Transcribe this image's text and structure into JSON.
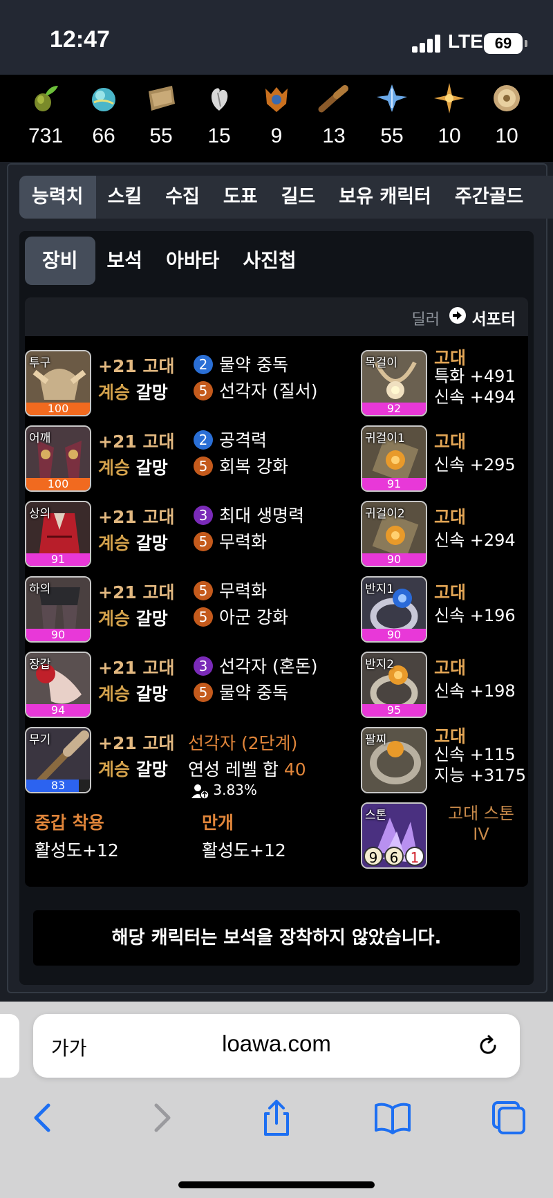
{
  "status_bar": {
    "time": "12:47",
    "network": "LTE",
    "battery": "69"
  },
  "resources": [
    {
      "icon": "sprout-icon",
      "value": "731"
    },
    {
      "icon": "orb-icon",
      "value": "66"
    },
    {
      "icon": "map-icon",
      "value": "55"
    },
    {
      "icon": "heart-icon",
      "value": "15"
    },
    {
      "icon": "mask-icon",
      "value": "9"
    },
    {
      "icon": "telescope-icon",
      "value": "13"
    },
    {
      "icon": "leaf-icon",
      "value": "55"
    },
    {
      "icon": "star-icon",
      "value": "10"
    },
    {
      "icon": "coin-icon",
      "value": "10"
    }
  ],
  "main_tabs": [
    "능력치",
    "스킬",
    "수집",
    "도표",
    "길드",
    "보유 캐릭터",
    "주간골드"
  ],
  "sub_tabs": [
    "장비",
    "보석",
    "아바타",
    "사진첩"
  ],
  "role": {
    "dealer": "딜러",
    "support": "서포터"
  },
  "equipment": [
    {
      "slot": "투구",
      "quality": "100",
      "enhance": "+21 고대",
      "tier": "계승",
      "set": "갈망",
      "eng1_n": "2",
      "eng1": "물약 중독",
      "eng2_n": "5",
      "eng2": "선각자 (질서)"
    },
    {
      "slot": "어깨",
      "quality": "100",
      "enhance": "+21 고대",
      "tier": "계승",
      "set": "갈망",
      "eng1_n": "2",
      "eng1": "공격력",
      "eng2_n": "5",
      "eng2": "회복 강화"
    },
    {
      "slot": "상의",
      "quality": "91",
      "enhance": "+21 고대",
      "tier": "계승",
      "set": "갈망",
      "eng1_n": "3",
      "eng1": "최대 생명력",
      "eng2_n": "5",
      "eng2": "무력화"
    },
    {
      "slot": "하의",
      "quality": "90",
      "enhance": "+21 고대",
      "tier": "계승",
      "set": "갈망",
      "eng1_n": "5",
      "eng1": "무력화",
      "eng2_n": "5",
      "eng2": "아군 강화"
    },
    {
      "slot": "장갑",
      "quality": "94",
      "enhance": "+21 고대",
      "tier": "계승",
      "set": "갈망",
      "eng1_n": "3",
      "eng1": "선각자 (혼돈)",
      "eng2_n": "5",
      "eng2": "물약 중독"
    }
  ],
  "weapon": {
    "slot": "무기",
    "quality": "83",
    "quality_fraction": 0.83,
    "enhance": "+21 고대",
    "tier": "계승",
    "set": "갈망",
    "elixir_title": "선각자 (2단계)",
    "elixir_label": "연성 레벨 합",
    "elixir_value": "40",
    "bonus": "3.83%"
  },
  "armor_summary": [
    {
      "title": "중갑 착용",
      "value": "활성도+12"
    },
    {
      "title": "만개",
      "value": "활성도+12"
    }
  ],
  "accessories": [
    {
      "slot": "목걸이",
      "quality": "92",
      "grade": "고대",
      "stats": [
        "특화 +491",
        "신속 +494"
      ]
    },
    {
      "slot": "귀걸이1",
      "quality": "91",
      "grade": "고대",
      "stats": [
        "신속 +295"
      ]
    },
    {
      "slot": "귀걸이2",
      "quality": "90",
      "grade": "고대",
      "stats": [
        "신속 +294"
      ]
    },
    {
      "slot": "반지1",
      "quality": "90",
      "grade": "고대",
      "stats": [
        "신속 +196"
      ]
    },
    {
      "slot": "반지2",
      "quality": "95",
      "grade": "고대",
      "stats": [
        "신속 +198"
      ]
    },
    {
      "slot": "팔찌",
      "quality": "",
      "grade": "고대",
      "stats": [
        "신속 +115",
        "지능 +3175"
      ]
    }
  ],
  "stone": {
    "slot": "스톤",
    "name": "고대 스톤",
    "tier": "IV",
    "n1": "9",
    "n2": "6",
    "n3": "1"
  },
  "notice": "해당 캐릭터는 보석을 장착하지 않았습니다.",
  "browser": {
    "text_size": "가가",
    "url": "loawa.com"
  }
}
